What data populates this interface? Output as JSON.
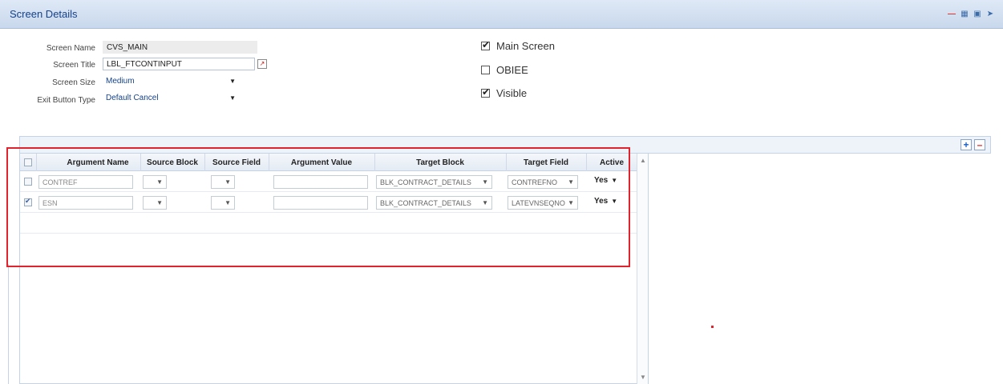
{
  "window": {
    "title": "Screen Details"
  },
  "form": {
    "screen_name": {
      "label": "Screen Name",
      "value": "CVS_MAIN"
    },
    "screen_title": {
      "label": "Screen Title",
      "value": "LBL_FTCONTINPUT"
    },
    "screen_size": {
      "label": "Screen Size",
      "value": "Medium"
    },
    "exit_button_type": {
      "label": "Exit Button Type",
      "value": "Default Cancel"
    }
  },
  "checkboxes": {
    "main_screen": {
      "label": "Main Screen",
      "checked": true
    },
    "obiee": {
      "label": "OBIEE",
      "checked": false
    },
    "visible": {
      "label": "Visible",
      "checked": true
    }
  },
  "grid": {
    "columns": [
      "Argument Name",
      "Source Block",
      "Source Field",
      "Argument Value",
      "Target Block",
      "Target Field",
      "Active"
    ],
    "rows": [
      {
        "checked": false,
        "argument_name": "CONTREF",
        "source_block": "",
        "source_field": "",
        "argument_value": "",
        "target_block": "BLK_CONTRACT_DETAILS",
        "target_field": "CONTREFNO",
        "active": "Yes"
      },
      {
        "checked": true,
        "argument_name": "ESN",
        "source_block": "",
        "source_field": "",
        "argument_value": "",
        "target_block": "BLK_CONTRACT_DETAILS",
        "target_field": "LATEVNSEQNO",
        "active": "Yes"
      }
    ]
  },
  "icons": {
    "minimize": "minimize-icon",
    "restore": "restore-icon",
    "maximize": "maximize-icon",
    "help": "help-icon",
    "add_row": "plus-icon",
    "remove_row": "minus-icon"
  },
  "colors": {
    "title_text": "#15428b",
    "highlight_border": "#e0242e",
    "header_bg": "#dfe9f6"
  }
}
